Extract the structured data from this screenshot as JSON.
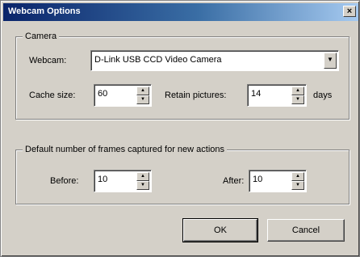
{
  "window": {
    "title": "Webcam Options",
    "close_glyph": "×"
  },
  "camera_group": {
    "label": "Camera",
    "webcam_label": "Webcam:",
    "webcam_value": "D-Link USB CCD Video Camera",
    "cache_label": "Cache size:",
    "cache_value": "60",
    "retain_label": "Retain pictures:",
    "retain_value": "14",
    "retain_unit": "days"
  },
  "frames_group": {
    "label": "Default number of frames captured for new actions",
    "before_label": "Before:",
    "before_value": "10",
    "after_label": "After:",
    "after_value": "10"
  },
  "buttons": {
    "ok": "OK",
    "cancel": "Cancel"
  },
  "icons": {
    "spin_up": "▲",
    "spin_down": "▼",
    "combo_arrow": "▼"
  }
}
